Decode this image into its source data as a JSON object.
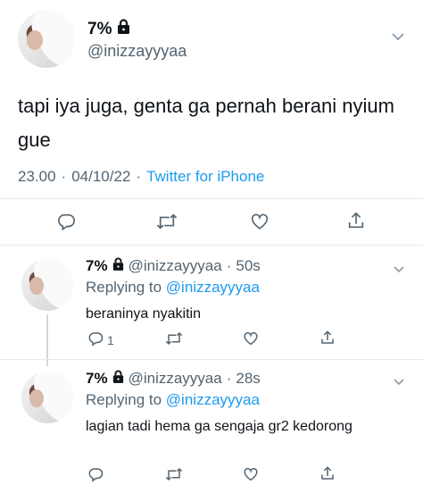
{
  "main_tweet": {
    "name": "7%",
    "handle": "@inizzayyyaa",
    "text": "tapi iya juga, genta ga pernah berani nyium gue",
    "time": "23.00",
    "date": "04/10/22",
    "separator": "·",
    "source": "Twitter for iPhone"
  },
  "replies": [
    {
      "name": "7%",
      "handle": "@inizzayyyaa",
      "sep": "·",
      "age": "50s",
      "replying_label": "Replying to",
      "replying_to": "@inizzayyyaa",
      "text": "beraninya nyakitin",
      "reply_count": "1"
    },
    {
      "name": "7%",
      "handle": "@inizzayyyaa",
      "sep": "·",
      "age": "28s",
      "replying_label": "Replying to",
      "replying_to": "@inizzayyyaa",
      "text": "lagian tadi hema ga sengaja gr2 kedorong",
      "reply_count": ""
    }
  ],
  "colors": {
    "accent": "#1d9bf0",
    "secondary_text": "#536471",
    "primary_text": "#0f1419",
    "divider": "#e7e9ea"
  },
  "icons": [
    "lock-icon",
    "chevron-down-icon",
    "reply-icon",
    "retweet-icon",
    "like-icon",
    "share-icon"
  ]
}
